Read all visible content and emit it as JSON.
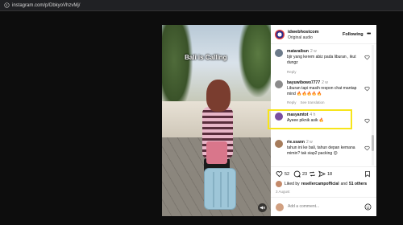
{
  "browser": {
    "url": "instagram.com/p/DbkyoVhzvMj/"
  },
  "video": {
    "caption": "Bali is Calling",
    "icons": {
      "mute": "mute-icon"
    }
  },
  "post": {
    "author": "idwebhostcom",
    "subtitle": "Original audio",
    "follow_label": "Following",
    "more_label": "•••"
  },
  "comments": [
    {
      "user": "mataraibun",
      "time": "2 w",
      "text": "bjir yang kerem abiz pada liburan , ikut dungz",
      "actions": [
        "Reply"
      ],
      "avatar_color": "#6c7a89"
    },
    {
      "user": "bayuwibowo7777",
      "time": "2 w",
      "text": "Liburan tapi masih respon chat mantap mind 🔥🔥🔥🔥🔥",
      "actions": [
        "Reply",
        "See translation"
      ],
      "avatar_color": "#8b8b8b"
    },
    {
      "user": "masyamtot",
      "time": "4 h",
      "text": "Ayeee piknik asik 🔥",
      "actions": [],
      "avatar_color": "#7a4fa0"
    },
    {
      "user": "rie.ssann",
      "time": "2 w",
      "text": "tahun ini ke bali, tahun depan kemana mimin? tak siap2 packing 😊",
      "actions": [],
      "avatar_color": "#a67c5b"
    }
  ],
  "actions": {
    "likes": "52",
    "comments": "23",
    "shares": "18"
  },
  "liked_by": {
    "prefix": "Liked by",
    "user": "resellercampofficial",
    "and": "and",
    "others": "51 others"
  },
  "date": "3 August",
  "add_comment": {
    "placeholder": "Add a comment..."
  }
}
